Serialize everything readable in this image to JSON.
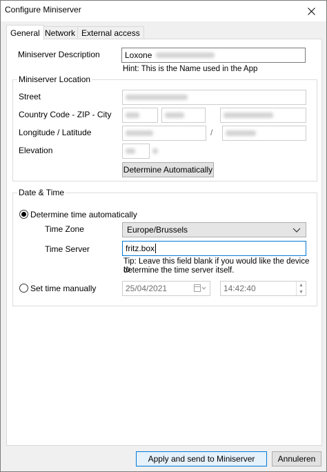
{
  "window": {
    "title": "Configure Miniserver"
  },
  "tabs": [
    {
      "label": "General"
    },
    {
      "label": "Network"
    },
    {
      "label": "External access"
    }
  ],
  "general": {
    "description_label": "Miniserver Description",
    "description_value": "Loxone",
    "description_hint": "Hint: This is the Name used in the App",
    "location_group": "Miniserver Location",
    "street_label": "Street",
    "country_label": "Country Code - ZIP - City",
    "lonlat_label": "Longitude / Latitude",
    "lonlat_separator": "/",
    "elevation_label": "Elevation",
    "determine_button": "Determine Automatically"
  },
  "datetime": {
    "group": "Date & Time",
    "auto_label": "Determine time automatically",
    "auto_selected": true,
    "timezone_label": "Time Zone",
    "timezone_value": "Europe/Brussels",
    "timeserver_label": "Time Server",
    "timeserver_value": "fritz.box",
    "tip_line1": "Tip: Leave this field blank if you would like the device to",
    "tip_line2": "determine the time server itself.",
    "manual_label": "Set time manually",
    "manual_selected": false,
    "date_value": "25/04/2021",
    "time_value": "14:42:40"
  },
  "footer": {
    "apply_button": "Apply and send to Miniserver",
    "cancel_button": "Annuleren"
  }
}
